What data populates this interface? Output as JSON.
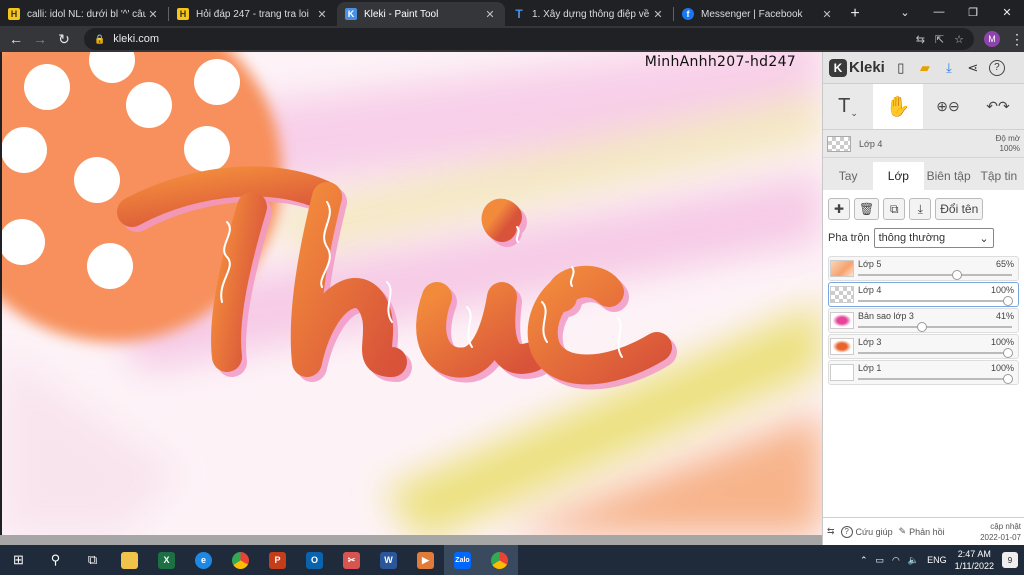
{
  "browser": {
    "tabs": [
      {
        "title": "calli: idol NL: dưới bl '^' câu h",
        "favicon": "H",
        "favicon_color": "#f5c518",
        "active": false
      },
      {
        "title": "Hỏi đáp 247 - trang tra loi",
        "favicon": "H",
        "favicon_color": "#f5c518",
        "active": false
      },
      {
        "title": "Kleki - Paint Tool",
        "favicon": "K",
        "favicon_color": "#4a90e2",
        "active": true
      },
      {
        "title": "1. Xây dựng thông điệp về c",
        "favicon": "T",
        "favicon_color": "#4a90e2",
        "active": false
      },
      {
        "title": "Messenger | Facebook",
        "favicon": "f",
        "favicon_color": "#1877f2",
        "active": false
      }
    ],
    "close_glyph": "✕",
    "new_tab": "+",
    "window_controls": [
      "⌄",
      "—",
      "❐",
      "✕"
    ],
    "back": "←",
    "forward": "→",
    "reload": "↻",
    "url": "kleki.com",
    "profile_initial": "M"
  },
  "canvas": {
    "artwork_word": "Thức",
    "watermark": "MinhAnhh207-hd247"
  },
  "kleki": {
    "logo": "Kleki",
    "top_icons": [
      "new-file-icon",
      "open-folder-icon",
      "download-icon",
      "share-icon",
      "help-icon"
    ],
    "tools": [
      {
        "name": "text",
        "glyph": "T"
      },
      {
        "name": "hand",
        "glyph": "✋"
      },
      {
        "name": "zoom",
        "glyph": "⊕⊖"
      },
      {
        "name": "undo-redo",
        "glyph": "↶↷"
      }
    ],
    "current_layer": "Lớp 4",
    "opacity_label": "Độ mờ",
    "opacity_value": "100%",
    "tabs": [
      "Tay",
      "Lớp",
      "Biên tập",
      "Tập tin"
    ],
    "active_tab": "Lớp",
    "rename_label": "Đổi tên",
    "blend_label": "Pha trộn",
    "blend_value": "thông thường",
    "layers": [
      {
        "name": "Lớp 5",
        "opacity": "65%",
        "opacity_value": 0.65,
        "thumb": "pattern"
      },
      {
        "name": "Lớp 4",
        "opacity": "100%",
        "opacity_value": 1.0,
        "thumb": "checker",
        "active": true
      },
      {
        "name": "Bản sao lớp 3",
        "opacity": "41%",
        "opacity_value": 0.41,
        "thumb": "pink"
      },
      {
        "name": "Lớp 3",
        "opacity": "100%",
        "opacity_value": 1.0,
        "thumb": "orange"
      },
      {
        "name": "Lớp 1",
        "opacity": "100%",
        "opacity_value": 1.0,
        "thumb": "white"
      }
    ],
    "footer": {
      "help_label": "Cứu giúp",
      "feedback_label": "Phản hồi",
      "update_label": "cập nhật",
      "update_date": "2022-01-07"
    }
  },
  "taskbar": {
    "language": "ENG",
    "time": "2:47 AM",
    "date": "1/11/2022",
    "notifications": "9"
  }
}
